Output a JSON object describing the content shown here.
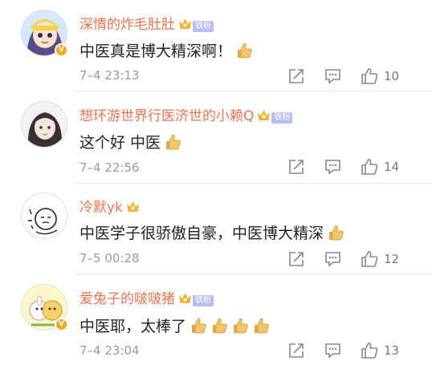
{
  "comments": [
    {
      "username": "深情的炸毛肚肚",
      "tag": "铁粉",
      "content": "中医真是博大精深啊！",
      "emoji_count": 1,
      "time": "7–4 23:13",
      "likes": "10"
    },
    {
      "username": "想环游世界行医济世的小赖Q",
      "tag": "铁粉",
      "content": "这个好 中医",
      "emoji_count": 1,
      "time": "7–4 22:56",
      "likes": "14"
    },
    {
      "username": "冷默yk",
      "tag": "",
      "content": "中医学子很骄傲自豪，中医博大精深",
      "emoji_count": 1,
      "time": "7–5 00:28",
      "likes": "12"
    },
    {
      "username": "爱兔子的啵啵猪",
      "tag": "铁粉",
      "content": "中医耶，太棒了",
      "emoji_count": 4,
      "time": "7–4 23:04",
      "likes": "13"
    }
  ],
  "colors": {
    "username": "#eb7350",
    "crown": "#f5b335",
    "tag_bg": "#b8bff0",
    "meta": "#9a9a9a",
    "thumb": "#f2c56f"
  },
  "icons": {
    "share": "share-icon",
    "comment": "comment-icon",
    "like": "like-icon",
    "crown": "crown-icon",
    "thumb_emoji": "thumbs-up-emoji"
  }
}
